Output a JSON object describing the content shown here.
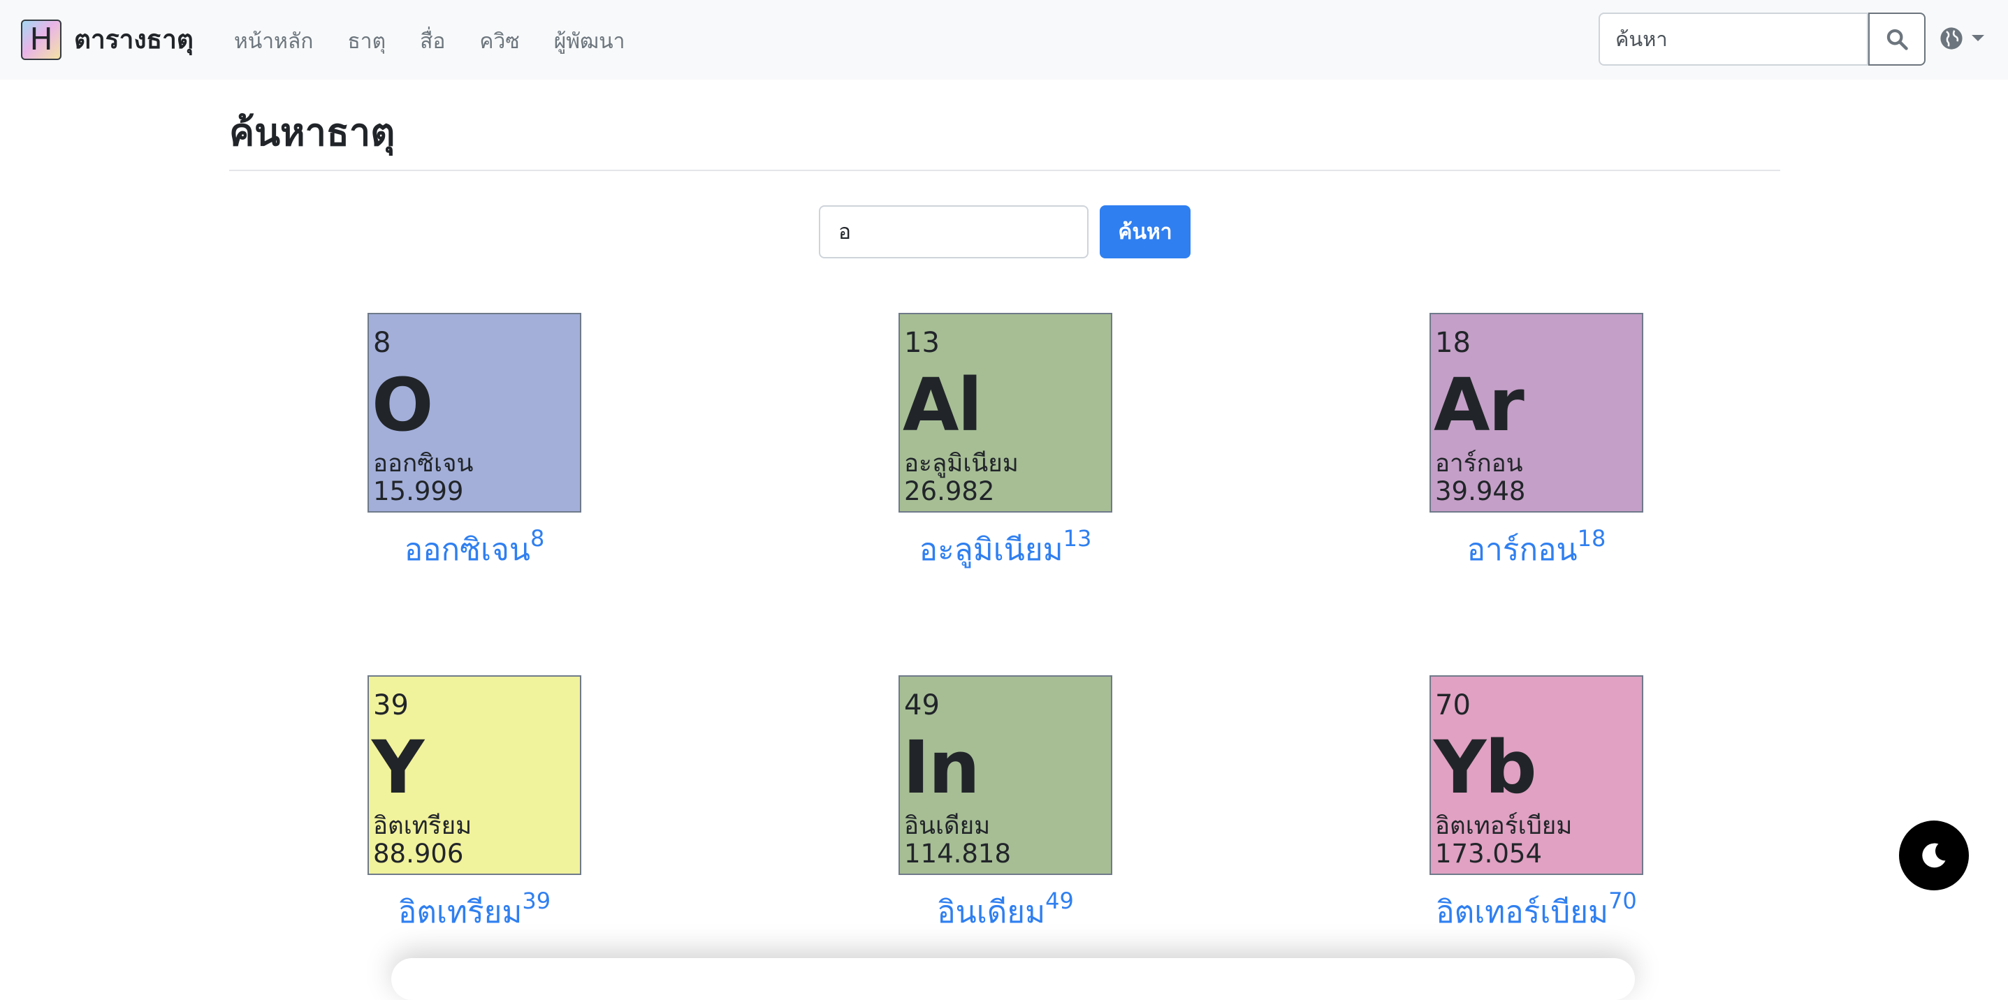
{
  "navbar": {
    "logo_letter": "H",
    "brand": "ตารางธาตุ",
    "links": [
      "หน้าหลัก",
      "ธาตุ",
      "สื่อ",
      "ควิซ",
      "ผู้พัฒนา"
    ],
    "search_placeholder": "ค้นหา"
  },
  "main": {
    "title": "ค้นหาธาตุ",
    "search_value": "อ",
    "search_button": "ค้นหา"
  },
  "elements": [
    {
      "number": "8",
      "symbol": "O",
      "name": "ออกซิเจน",
      "mass": "15.999",
      "color": "#a3afd9"
    },
    {
      "number": "13",
      "symbol": "Al",
      "name": "อะลูมิเนียม",
      "mass": "26.982",
      "color": "#a7be95"
    },
    {
      "number": "18",
      "symbol": "Ar",
      "name": "อาร์กอน",
      "mass": "39.948",
      "color": "#c49fc7"
    },
    {
      "number": "39",
      "symbol": "Y",
      "name": "อิตเทรียม",
      "mass": "88.906",
      "color": "#f1f29c"
    },
    {
      "number": "49",
      "symbol": "In",
      "name": "อินเดียม",
      "mass": "114.818",
      "color": "#a7be95"
    },
    {
      "number": "70",
      "symbol": "Yb",
      "name": "อิตเทอร์เบียม",
      "mass": "173.054",
      "color": "#e0a1c2"
    }
  ],
  "colors": {
    "accent": "#2f7ff0",
    "navbar_bg": "#f8f9fa"
  },
  "icons": [
    "search-icon",
    "globe-icon",
    "moon-icon"
  ]
}
